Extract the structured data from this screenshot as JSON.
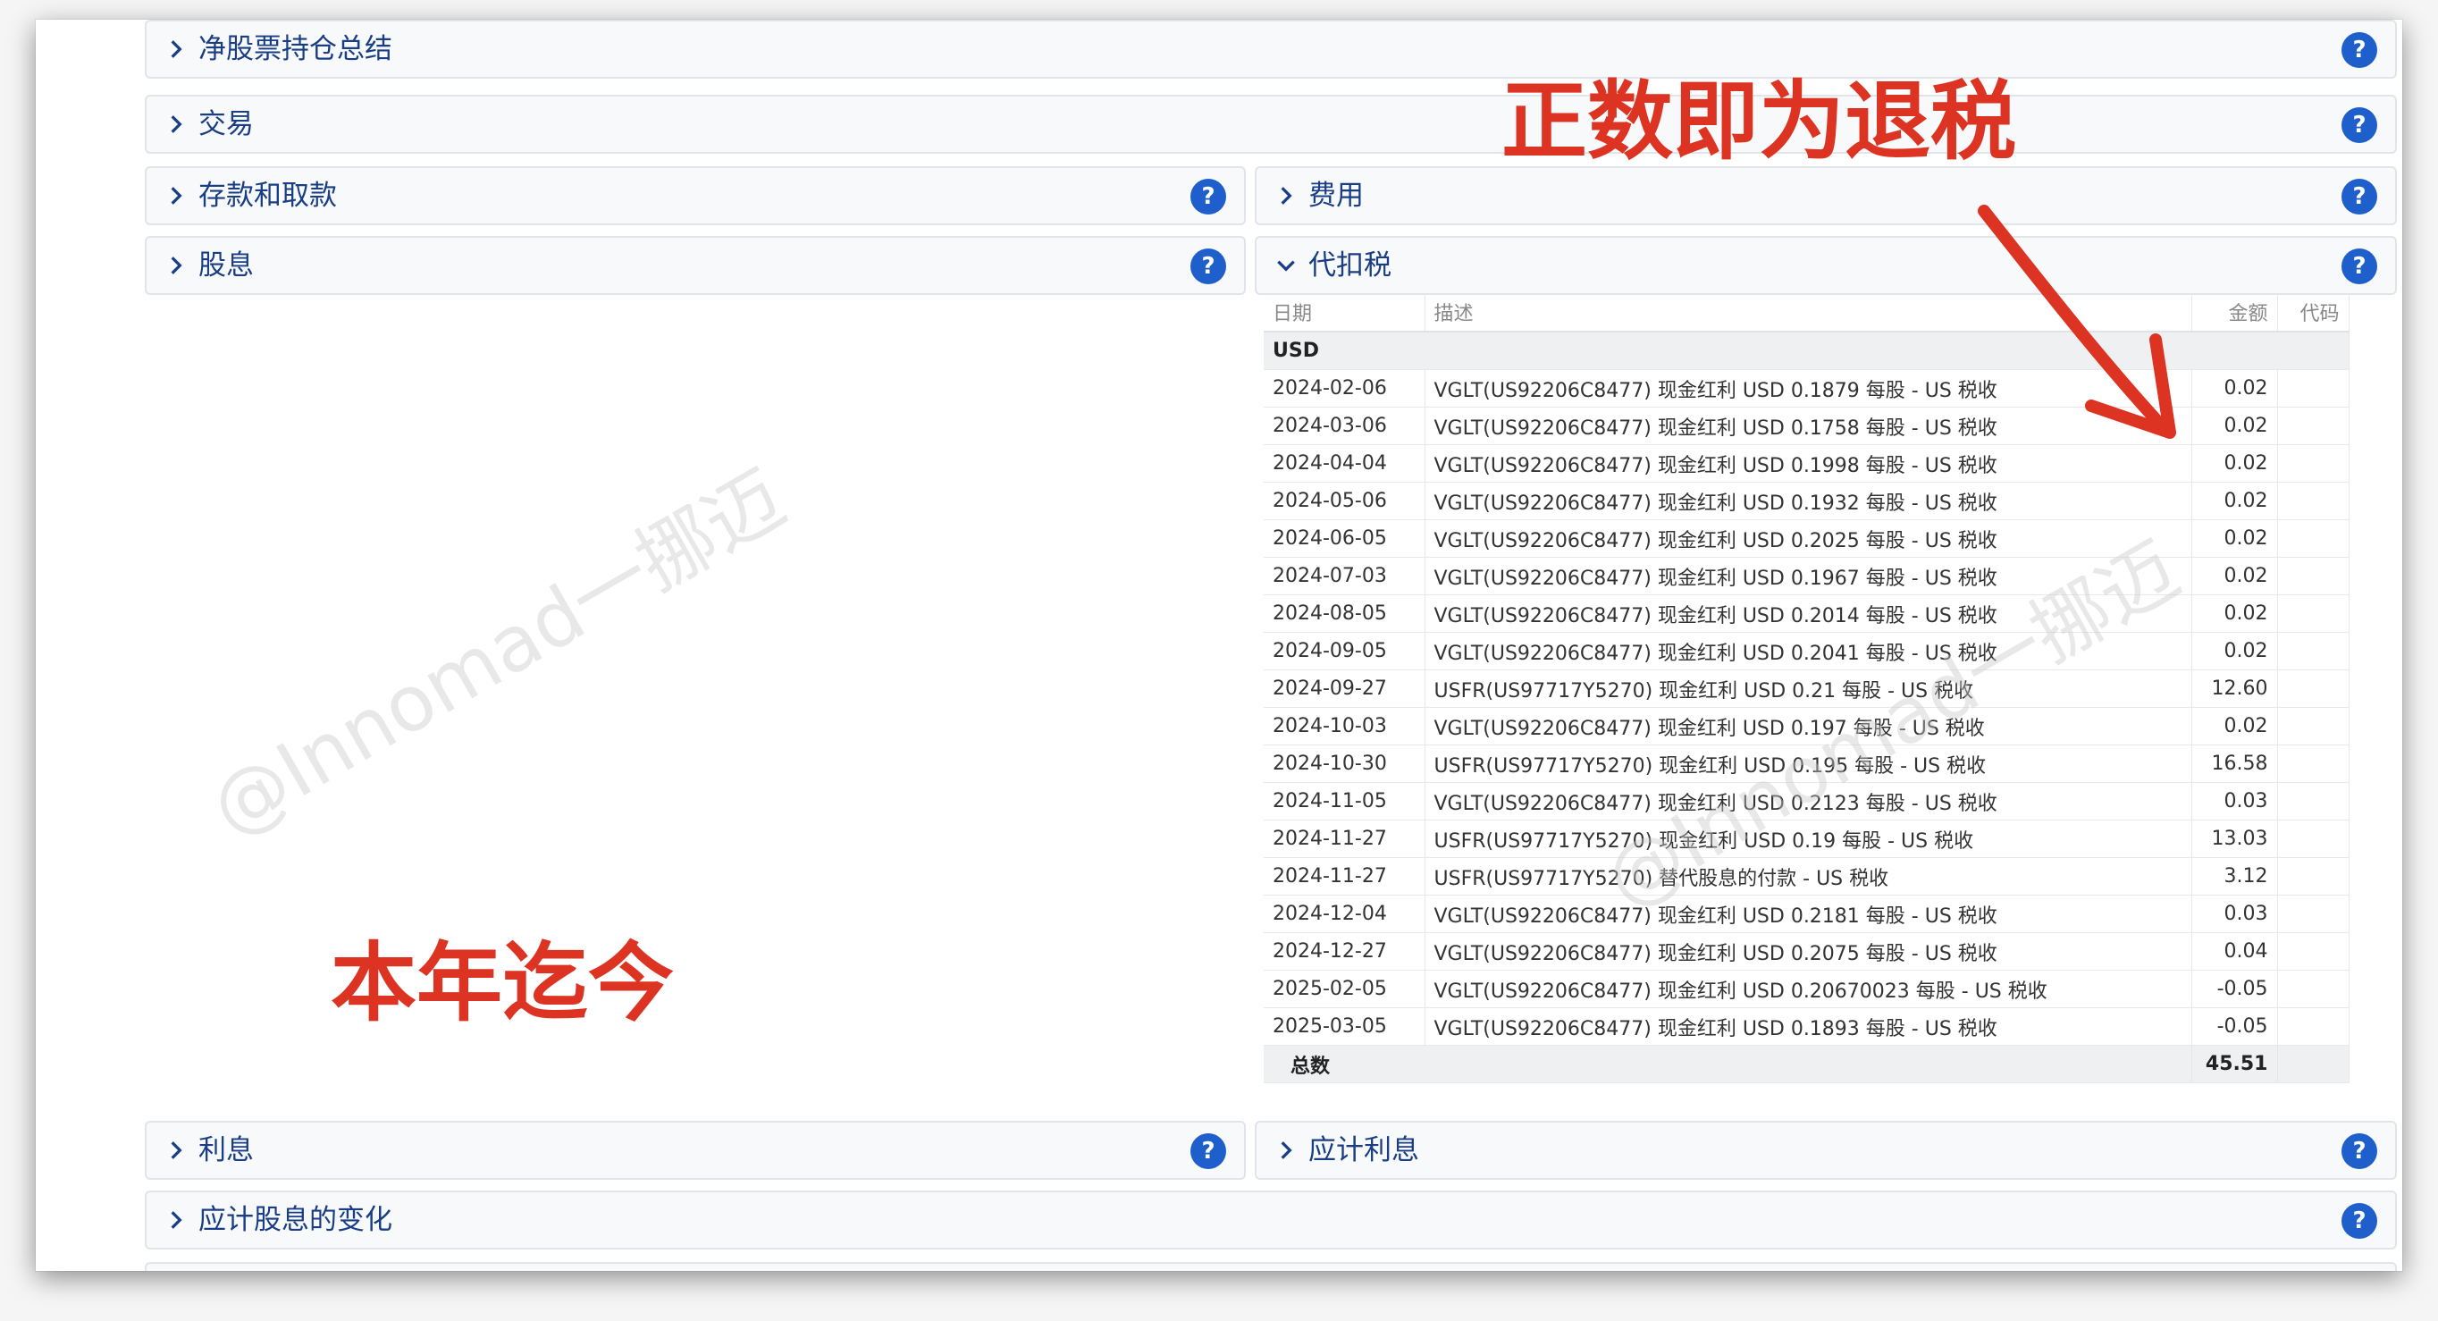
{
  "sections": {
    "net_stock": "净股票持仓总结",
    "trades": "交易",
    "deposits": "存款和取款",
    "fees": "费用",
    "dividends": "股息",
    "withholding": "代扣税",
    "interest": "利息",
    "accrued_interest": "应计利息",
    "accrued_dividend_changes": "应计股息的变化"
  },
  "help_icon": "?",
  "table": {
    "headers": {
      "date": "日期",
      "desc": "描述",
      "amount": "金额",
      "code": "代码"
    },
    "currency": "USD",
    "rows": [
      {
        "date": "2024-02-06",
        "desc": "VGLT(US92206C8477) 现金红利 USD 0.1879 每股 - US 税收",
        "amount": "0.02"
      },
      {
        "date": "2024-03-06",
        "desc": "VGLT(US92206C8477) 现金红利 USD 0.1758 每股 - US 税收",
        "amount": "0.02"
      },
      {
        "date": "2024-04-04",
        "desc": "VGLT(US92206C8477) 现金红利 USD 0.1998 每股 - US 税收",
        "amount": "0.02"
      },
      {
        "date": "2024-05-06",
        "desc": "VGLT(US92206C8477) 现金红利 USD 0.1932 每股 - US 税收",
        "amount": "0.02"
      },
      {
        "date": "2024-06-05",
        "desc": "VGLT(US92206C8477) 现金红利 USD 0.2025 每股 - US 税收",
        "amount": "0.02"
      },
      {
        "date": "2024-07-03",
        "desc": "VGLT(US92206C8477) 现金红利 USD 0.1967 每股 - US 税收",
        "amount": "0.02"
      },
      {
        "date": "2024-08-05",
        "desc": "VGLT(US92206C8477) 现金红利 USD 0.2014 每股 - US 税收",
        "amount": "0.02"
      },
      {
        "date": "2024-09-05",
        "desc": "VGLT(US92206C8477) 现金红利 USD 0.2041 每股 - US 税收",
        "amount": "0.02"
      },
      {
        "date": "2024-09-27",
        "desc": "USFR(US97717Y5270) 现金红利 USD 0.21 每股 - US 税收",
        "amount": "12.60"
      },
      {
        "date": "2024-10-03",
        "desc": "VGLT(US92206C8477) 现金红利 USD 0.197 每股 - US 税收",
        "amount": "0.02"
      },
      {
        "date": "2024-10-30",
        "desc": "USFR(US97717Y5270) 现金红利 USD 0.195 每股 - US 税收",
        "amount": "16.58"
      },
      {
        "date": "2024-11-05",
        "desc": "VGLT(US92206C8477) 现金红利 USD 0.2123 每股 - US 税收",
        "amount": "0.03"
      },
      {
        "date": "2024-11-27",
        "desc": "USFR(US97717Y5270) 现金红利 USD 0.19 每股 - US 税收",
        "amount": "13.03"
      },
      {
        "date": "2024-11-27",
        "desc": "USFR(US97717Y5270) 替代股息的付款 - US 税收",
        "amount": "3.12"
      },
      {
        "date": "2024-12-04",
        "desc": "VGLT(US92206C8477) 现金红利 USD 0.2181 每股 - US 税收",
        "amount": "0.03"
      },
      {
        "date": "2024-12-27",
        "desc": "VGLT(US92206C8477) 现金红利 USD 0.2075 每股 - US 税收",
        "amount": "0.04"
      },
      {
        "date": "2025-02-05",
        "desc": "VGLT(US92206C8477) 现金红利 USD 0.20670023 每股 - US 税收",
        "amount": "-0.05"
      },
      {
        "date": "2025-03-05",
        "desc": "VGLT(US92206C8477) 现金红利 USD 0.1893 每股 - US 税收",
        "amount": "-0.05"
      }
    ],
    "total_label": "总数",
    "total_amount": "45.51"
  },
  "annotations": {
    "refund_note": "正数即为退税",
    "ytd_note": "本年迄今",
    "color": "#dd3322"
  },
  "watermark": "@Innomad一挪迈"
}
